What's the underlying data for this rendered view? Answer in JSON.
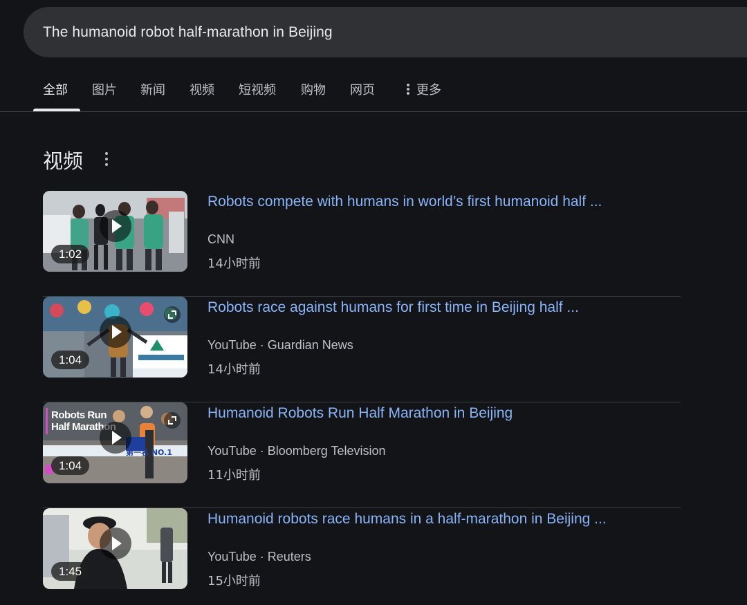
{
  "search": {
    "query": "The humanoid robot half-marathon in Beijing"
  },
  "tabs": [
    {
      "label": "全部"
    },
    {
      "label": "图片"
    },
    {
      "label": "新闻"
    },
    {
      "label": "视频"
    },
    {
      "label": "短视频"
    },
    {
      "label": "购物"
    },
    {
      "label": "网页"
    },
    {
      "label": "更多"
    }
  ],
  "section": {
    "title": "视频",
    "menu_icon": "more-vert-icon"
  },
  "videos": [
    {
      "title": "Robots compete with humans in world’s first humanoid half ...",
      "source": "CNN",
      "time": "14小时前",
      "duration": "1:02"
    },
    {
      "title": "Robots race against humans for first time in Beijing half ...",
      "source": "YouTube · Guardian News",
      "time": "14小时前",
      "duration": "1:04"
    },
    {
      "title": "Humanoid Robots Run Half Marathon in Beijing",
      "source": "YouTube · Bloomberg Television",
      "time": "11小时前",
      "duration": "1:04",
      "overlay_text": [
        "Robots Run",
        "Half Marathon"
      ],
      "banner_text": "第一名 NO.1"
    },
    {
      "title": "Humanoid robots race humans in a half-marathon in Beijing ...",
      "source": "YouTube · Reuters",
      "time": "15小时前",
      "duration": "1:45"
    }
  ],
  "colors": {
    "background": "#131418",
    "link": "#8ab4f8",
    "muted": "#bdc1c6",
    "search_bg": "#303134"
  }
}
